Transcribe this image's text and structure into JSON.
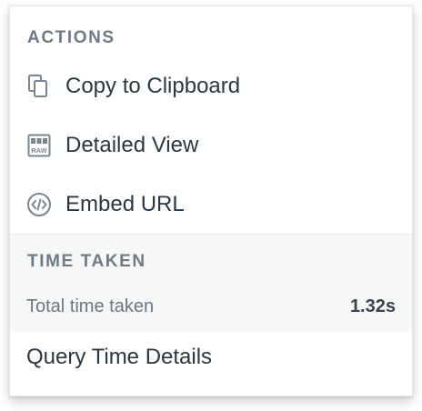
{
  "actions": {
    "title": "ACTIONS",
    "items": [
      {
        "label": "Copy to Clipboard",
        "icon": "copy-icon"
      },
      {
        "label": "Detailed View",
        "icon": "raw-view-icon",
        "badge": "RAW"
      },
      {
        "label": "Embed URL",
        "icon": "embed-code-icon"
      }
    ]
  },
  "time": {
    "title": "TIME TAKEN",
    "total_label": "Total time taken",
    "total_value": "1.32s"
  },
  "footer": {
    "query_details_label": "Query Time Details"
  }
}
